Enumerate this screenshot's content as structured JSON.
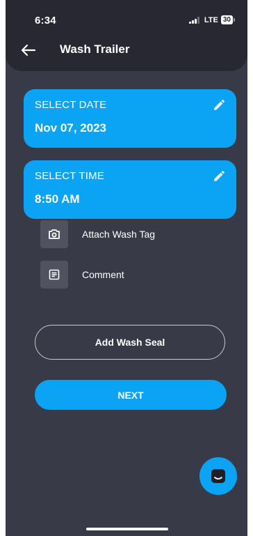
{
  "status": {
    "time": "6:34",
    "network": "LTE",
    "battery": "30"
  },
  "header": {
    "title": "Wash Trailer"
  },
  "date_card": {
    "label": "SELECT DATE",
    "value": "Nov 07, 2023"
  },
  "time_card": {
    "label": "SELECT TIME",
    "value": "8:50 AM"
  },
  "options": [
    {
      "label": "Attach Wash Tag",
      "icon": "camera-icon"
    },
    {
      "label": "Comment",
      "icon": "note-icon"
    }
  ],
  "buttons": {
    "add_seal": "Add Wash Seal",
    "next": "NEXT"
  },
  "colors": {
    "accent": "#0ba4f5",
    "background": "#383a47",
    "header": "#272832"
  }
}
